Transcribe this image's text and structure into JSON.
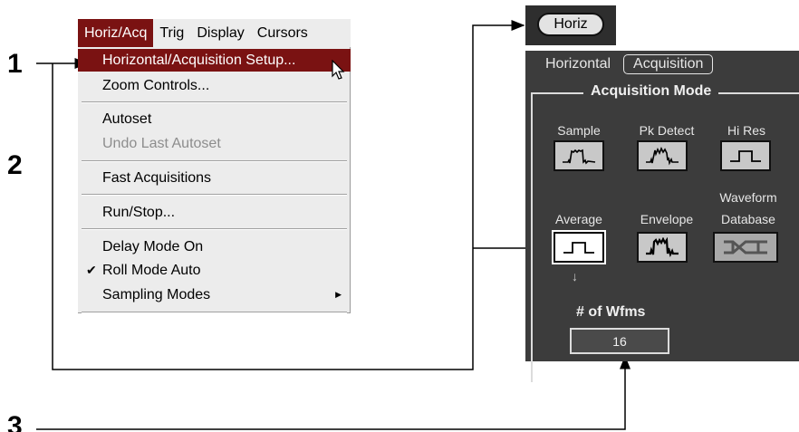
{
  "steps": [
    "1",
    "2",
    "3"
  ],
  "menubar": {
    "items": [
      {
        "label": "Horiz/Acq",
        "active": true
      },
      {
        "label": "Trig"
      },
      {
        "label": "Display"
      },
      {
        "label": "Cursors"
      }
    ]
  },
  "dropdown": {
    "horiz_acq_setup": "Horizontal/Acquisition Setup...",
    "zoom_controls": "Zoom Controls...",
    "autoset": "Autoset",
    "undo_autoset": "Undo Last Autoset",
    "fast_acquisitions": "Fast Acquisitions",
    "run_stop": "Run/Stop...",
    "delay_mode": "Delay Mode On",
    "roll_mode": "Roll Mode Auto",
    "roll_mode_checked": "✔",
    "sampling_modes": "Sampling Modes",
    "submenu_arrow": "▶"
  },
  "horiz_button": {
    "label": "Horiz"
  },
  "panel": {
    "tabs": [
      {
        "label": "Horizontal"
      },
      {
        "label": "Acquisition",
        "selected": true
      }
    ],
    "group_title": "Acquisition Mode",
    "modes": [
      {
        "label": "Sample",
        "icon": "sample-waveform-icon"
      },
      {
        "label": "Pk Detect",
        "icon": "peak-detect-waveform-icon"
      },
      {
        "label": "Hi Res",
        "icon": "hi-res-waveform-icon"
      },
      {
        "label": "Average",
        "icon": "average-waveform-icon",
        "selected": true
      },
      {
        "label": "Envelope",
        "icon": "envelope-waveform-icon"
      },
      {
        "label": "Waveform",
        "label2": "Database",
        "icon": "waveform-database-icon"
      }
    ],
    "selected_arrow": "↓",
    "wfms_label": "# of Wfms",
    "wfms_value": "16"
  }
}
